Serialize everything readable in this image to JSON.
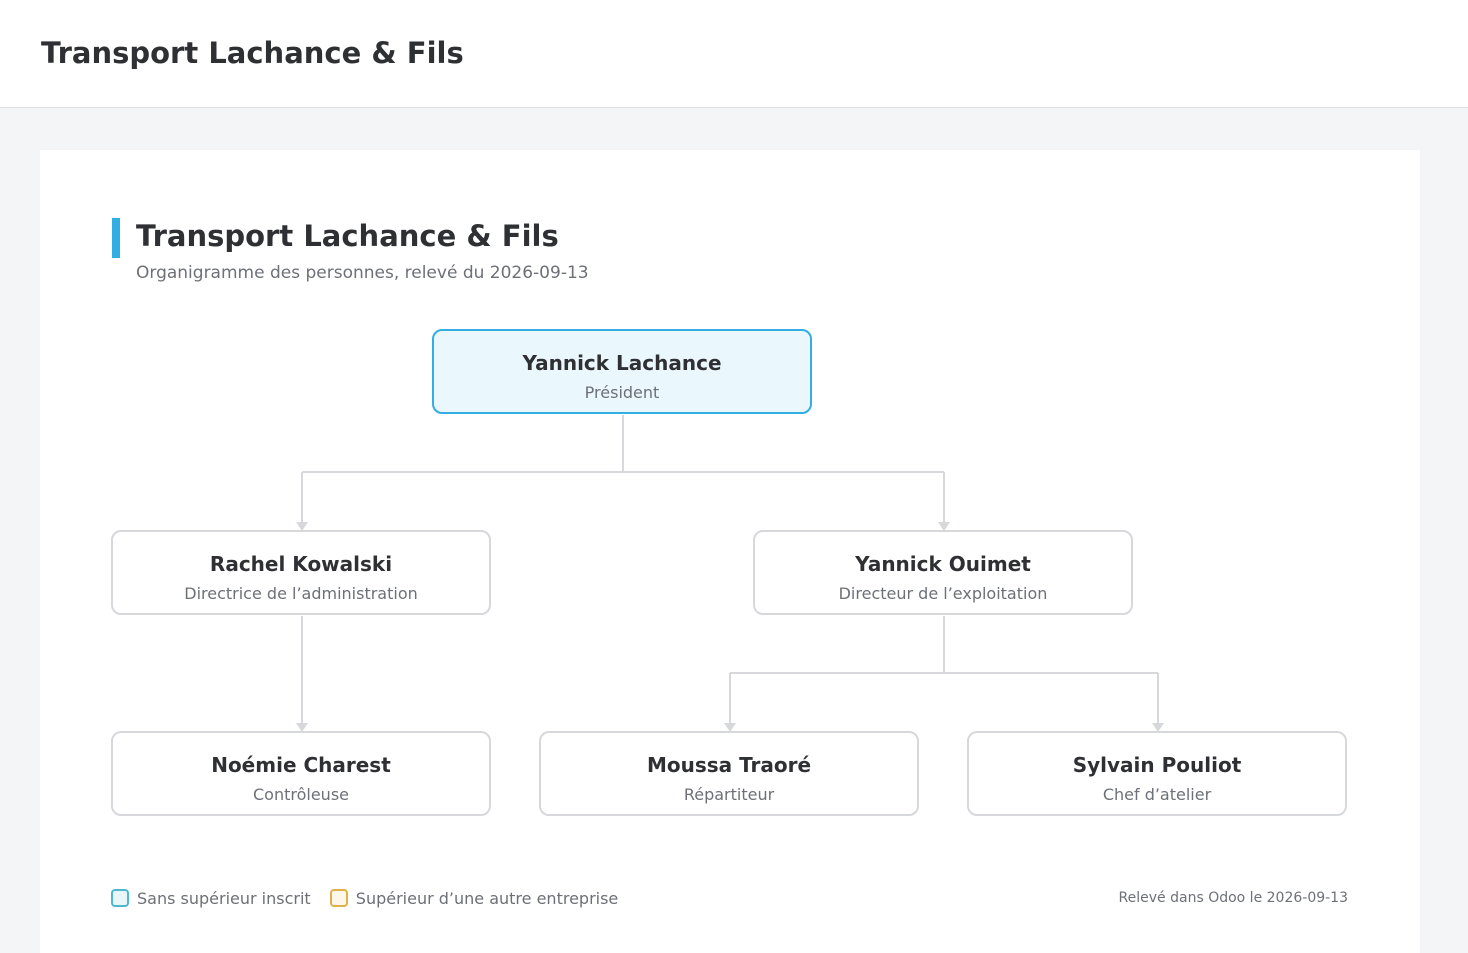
{
  "header": {
    "title": "Transport Lachance & Fils"
  },
  "chart": {
    "title": "Transport Lachance & Fils",
    "subtitle": "Organigramme des personnes, relevé du 2026-09-13"
  },
  "colors": {
    "accent": "#33aee3",
    "root_fill": "#eaf7fd",
    "node_border": "#d7d8db",
    "connector": "#d7d8db",
    "legend_no_superior_border": "#4fb8cf",
    "legend_no_superior_fill": "#e8f6f9",
    "legend_external_border": "#e2b04a",
    "legend_external_fill": "#fdf7ea"
  },
  "org": {
    "nodes": {
      "root": {
        "name": "Yannick Lachance",
        "role": "Président"
      },
      "admin": {
        "name": "Rachel Kowalski",
        "role": "Directrice de l’administration"
      },
      "ops": {
        "name": "Yannick Ouimet",
        "role": "Directeur de l’exploitation"
      },
      "controleuse": {
        "name": "Noémie Charest",
        "role": "Contrôleuse"
      },
      "repartiteur": {
        "name": "Moussa Traoré",
        "role": "Répartiteur"
      },
      "atelier": {
        "name": "Sylvain Pouliot",
        "role": "Chef d’atelier"
      }
    },
    "edges": [
      [
        "root",
        "admin"
      ],
      [
        "root",
        "ops"
      ],
      [
        "admin",
        "controleuse"
      ],
      [
        "ops",
        "repartiteur"
      ],
      [
        "ops",
        "atelier"
      ]
    ]
  },
  "legend": {
    "no_superior": "Sans supérieur inscrit",
    "external_superior": "Supérieur d’une autre entreprise"
  },
  "footer": {
    "note": "Relevé dans Odoo le 2026-09-13"
  }
}
